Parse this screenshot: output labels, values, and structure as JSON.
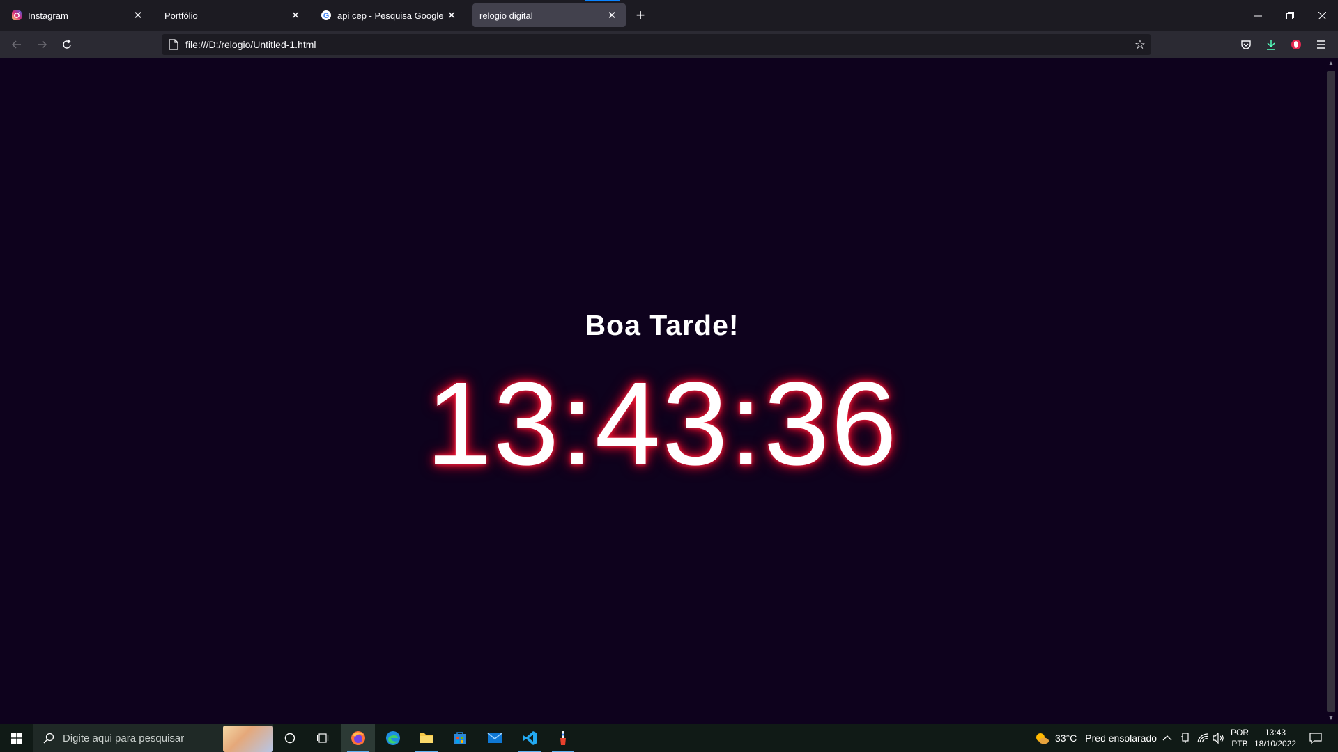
{
  "browser": {
    "tabs": [
      {
        "title": "Instagram",
        "icon": "instagram-icon",
        "active": false
      },
      {
        "title": "Portfólio",
        "icon": "none",
        "active": false
      },
      {
        "title": "api cep - Pesquisa Google",
        "icon": "google-icon",
        "active": false
      },
      {
        "title": "relogio digital",
        "icon": "none",
        "active": true
      }
    ],
    "new_tab": "+",
    "url": "file:///D:/relogio/Untitled-1.html"
  },
  "page": {
    "greeting": "Boa Tarde!",
    "clock": "13:43:36",
    "background_color": "#0e021d",
    "glow_color": "#ff1e3c"
  },
  "taskbar": {
    "search_placeholder": "Digite aqui para pesquisar",
    "weather_temp": "33°C",
    "weather_desc": "Pred ensolarado",
    "language_top": "POR",
    "language_bottom": "PTB",
    "time": "13:43",
    "date": "18/10/2022"
  }
}
